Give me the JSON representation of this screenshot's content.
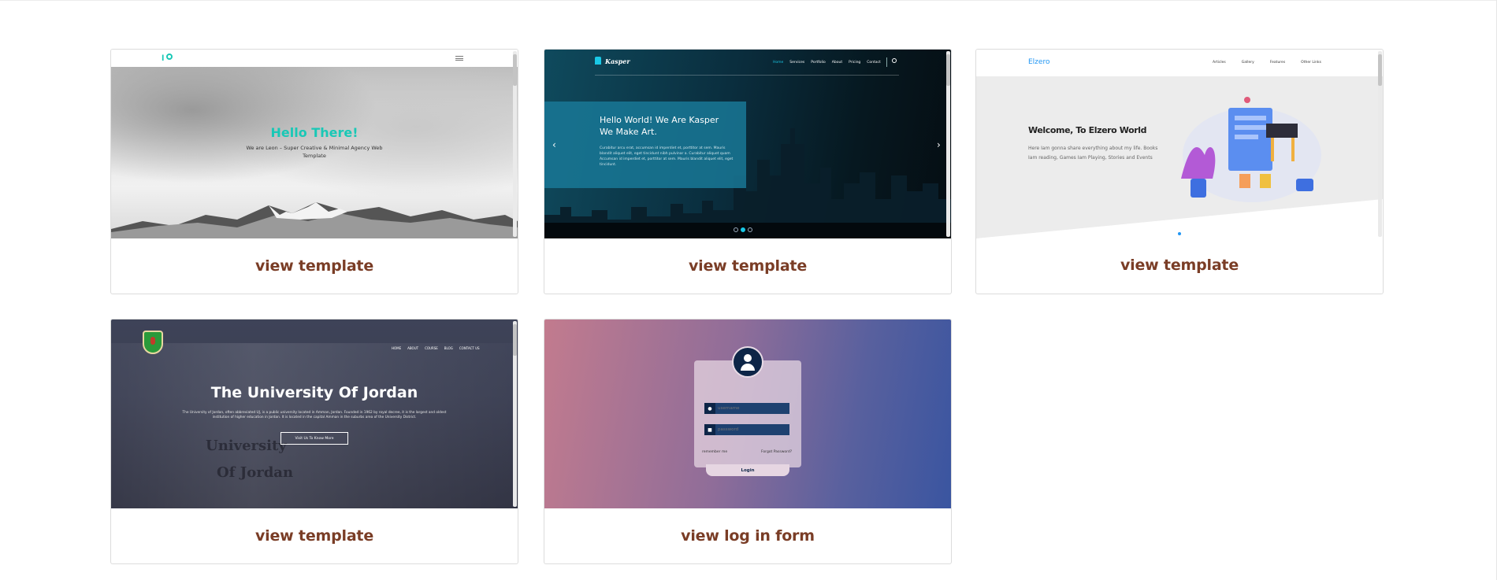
{
  "cards": [
    {
      "cta": "view template",
      "preview": {
        "logo": "l",
        "title": "Hello There!",
        "subtitle": "We are Leon – Super Creative & Minimal Agency Web Template"
      }
    },
    {
      "cta": "view template",
      "preview": {
        "brand": "Kasper",
        "menu": [
          "Home",
          "Services",
          "Portfolio",
          "About",
          "Pricing",
          "Contact"
        ],
        "title": "Hello World! We Are Kasper We Make Art.",
        "text": "Curabitur arcu erat, accumsan id imperdiet et, porttitor at sem. Mauris blandit aliquet elit, eget tincidunt nibh pulvinar a. Curabitur aliquet quam Accumsan id imperdiet et, porttitor at sem. Mauris blandit aliquet elit, eget tincidunt."
      }
    },
    {
      "cta": "view template",
      "preview": {
        "brand": "Elzero",
        "menu": [
          "Articles",
          "Gallery",
          "Features",
          "Other Links"
        ],
        "title": "Welcome, To Elzero World",
        "text": "Here Iam gonna share everything about my life. Books Iam reading, Games Iam Playing, Stories and Events"
      }
    },
    {
      "cta": "view template",
      "preview": {
        "menu": [
          "HOME",
          "ABOUT",
          "COURSE",
          "BLOG",
          "CONTACT US"
        ],
        "title": "The University Of Jordan",
        "text": "The University of Jordan, often abbreviated UJ, is a public university located in Amman, Jordan. Founded in 1962 by royal decree, it is the largest and oldest institution of higher education in Jordan. It is located in the capital Amman in the suburbs area of the University District.",
        "button": "Visit Us To Know More",
        "carving_line1": "University",
        "carving_line2": "Of Jordan"
      }
    },
    {
      "cta": "view log in form",
      "preview": {
        "username_placeholder": "username",
        "password_placeholder": "password",
        "remember": "remember me",
        "forgot": "Forgot Password?",
        "login": "Login"
      }
    }
  ],
  "colors": {
    "cta": "#7a3d26",
    "accent_teal": "#19c8b6",
    "accent_blue": "#2196f3"
  }
}
